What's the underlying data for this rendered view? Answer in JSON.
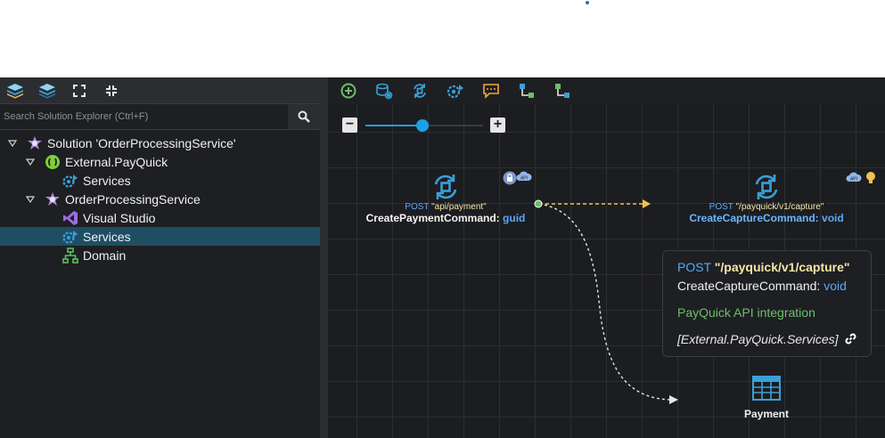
{
  "explorer": {
    "search_placeholder": "Search Solution Explorer (Ctrl+F)",
    "toolbar_icons": [
      "layers-icon",
      "layers-stack-icon",
      "expand-icon",
      "collapse-icon"
    ],
    "tree": [
      {
        "label": "Solution 'OrderProcessingService'",
        "icon": "solution-icon",
        "level": 0,
        "expanded": true
      },
      {
        "label": "External.PayQuick",
        "icon": "external-package-icon",
        "level": 1,
        "expanded": true
      },
      {
        "label": "Services",
        "icon": "services-icon",
        "level": 2
      },
      {
        "label": "OrderProcessingService",
        "icon": "solution-icon",
        "level": 1,
        "expanded": true
      },
      {
        "label": "Visual Studio",
        "icon": "visual-studio-icon",
        "level": 2
      },
      {
        "label": "Services",
        "icon": "services-icon",
        "level": 2,
        "selected": true
      },
      {
        "label": "Domain",
        "icon": "domain-icon",
        "level": 2
      }
    ]
  },
  "designer": {
    "toolbar_icons": [
      "add-icon",
      "database-icon",
      "command-icon",
      "service-icon",
      "comment-icon",
      "hierarchy-icon",
      "hierarchy-alt-icon"
    ],
    "nodes": {
      "payment_command": {
        "verb": "POST",
        "path": "\"api/payment\"",
        "name": "CreatePaymentCommand:",
        "returns": "guid"
      },
      "capture_command": {
        "verb": "POST",
        "path": "\"/payquick/v1/capture\"",
        "name": "CreateCaptureCommand:",
        "returns": "void"
      },
      "payment_entity": {
        "name": "Payment"
      }
    },
    "tooltip": {
      "verb": "POST",
      "path": "\"/payquick/v1/capture\"",
      "name": "CreateCaptureCommand:",
      "returns": "void",
      "description": "PayQuick API integration",
      "source": "[External.PayQuick.Services]"
    }
  },
  "colors": {
    "accent": "#19a2e8",
    "selected_row": "#1f4e63",
    "green": "#6ac06a",
    "yellow": "#f2c14e"
  }
}
